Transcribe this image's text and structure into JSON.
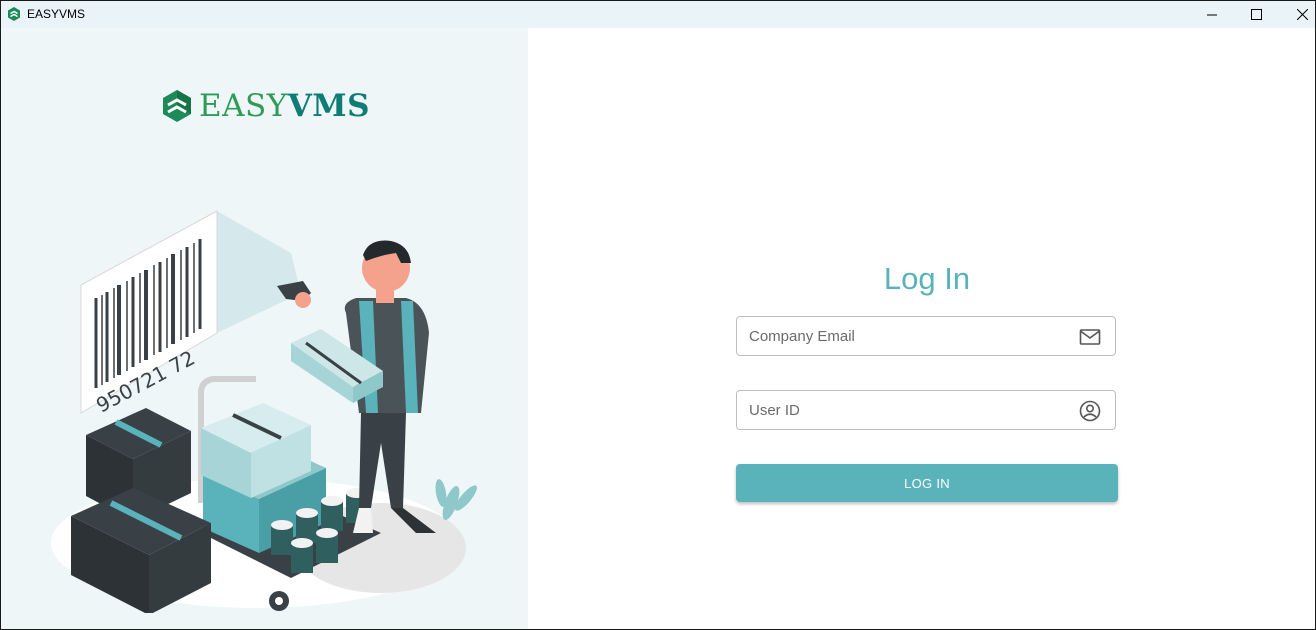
{
  "window": {
    "title": "EASYVMS",
    "controls": [
      "minimize",
      "maximize",
      "close"
    ]
  },
  "brand": {
    "logo_part1": "EASY",
    "logo_part2": "VMS",
    "color_green": "#2e9b57",
    "color_teal": "#0f7c76"
  },
  "illustration": {
    "barcode_number": "950721 72"
  },
  "login": {
    "title": "Log In",
    "email_placeholder": "Company Email",
    "email_icon": "envelope-icon",
    "userid_placeholder": "User ID",
    "userid_icon": "user-circle-icon",
    "button_label": "LOG IN",
    "accent_color": "#5ab2ba"
  }
}
